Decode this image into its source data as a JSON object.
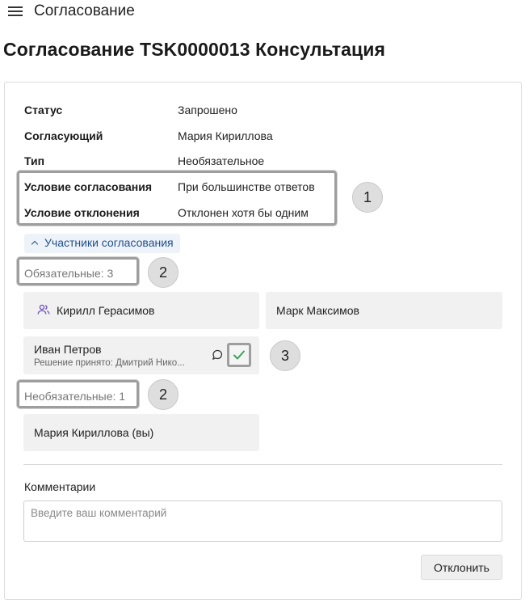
{
  "app": {
    "title": "Согласование"
  },
  "page": {
    "title": "Согласование TSK0000013 Консультация"
  },
  "details": [
    {
      "label": "Статус",
      "value": "Запрошено"
    },
    {
      "label": "Согласующий",
      "value": "Мария Кириллова"
    },
    {
      "label": "Тип",
      "value": "Необязательное"
    },
    {
      "label": "Условие согласования",
      "value": "При большинстве ответов"
    },
    {
      "label": "Условие отклонения",
      "value": "Отклонен хотя бы одним"
    }
  ],
  "participants": {
    "toggle_label": "Участники согласования",
    "required_label": "Обязательные: 3",
    "optional_label": "Необязательные: 1",
    "required": [
      {
        "name": "Кирилл Герасимов",
        "icon": "people-group-icon"
      },
      {
        "name": "Марк Максимов"
      },
      {
        "name": "Иван Петров",
        "status": "Решение принято: Дмитрий Нико..."
      }
    ],
    "optional": [
      {
        "name": "Мария Кириллова (вы)"
      }
    ]
  },
  "annotations": [
    "1",
    "2",
    "2",
    "3"
  ],
  "comments": {
    "label": "Комментарии",
    "placeholder": "Введите ваш комментарий",
    "value": ""
  },
  "actions": {
    "reject_label": "Отклонить"
  },
  "colors": {
    "accent": "#1f4e8c",
    "approved": "#3aa35a",
    "group_icon": "#7a5cc0",
    "highlight": "#9e9e9e"
  }
}
